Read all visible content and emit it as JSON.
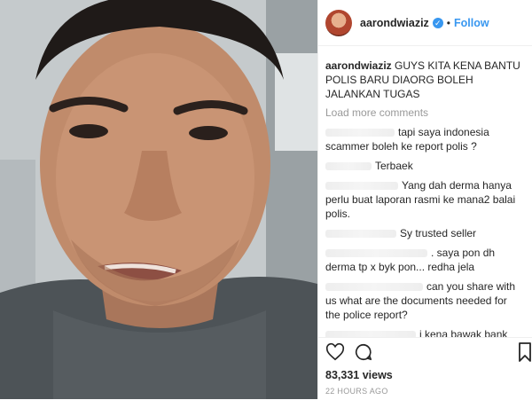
{
  "post": {
    "username": "aarondwiaziz",
    "follow_label": "Follow",
    "dot": "•",
    "verified_mark": "✓",
    "caption_username": "aarondwiaziz",
    "caption_text": " GUYS KITA KENA BANTU POLIS BARU DIAORG BOLEH JALANKAN TUGAS",
    "load_more": "Load more comments",
    "comments": [
      "tapi saya indonesia scammer boleh ke report polis ?",
      "Terbaek",
      "Yang dah derma hanya perlu buat laporan rasmi ke mana2 balai polis.",
      "Sy trusted seller",
      ". saya pon dh derma tp x byk pon... redha jela",
      "can you share with us what are the documents needed for the police report?",
      "i kena bawak bank statement ke?"
    ],
    "views": "83,331 views",
    "time_ago": "22 HOURS AGO"
  },
  "icons": [
    "heart-icon",
    "comment-icon",
    "bookmark-icon"
  ],
  "colors": {
    "accent": "#3897f0",
    "text": "#262626",
    "muted": "#999999"
  }
}
